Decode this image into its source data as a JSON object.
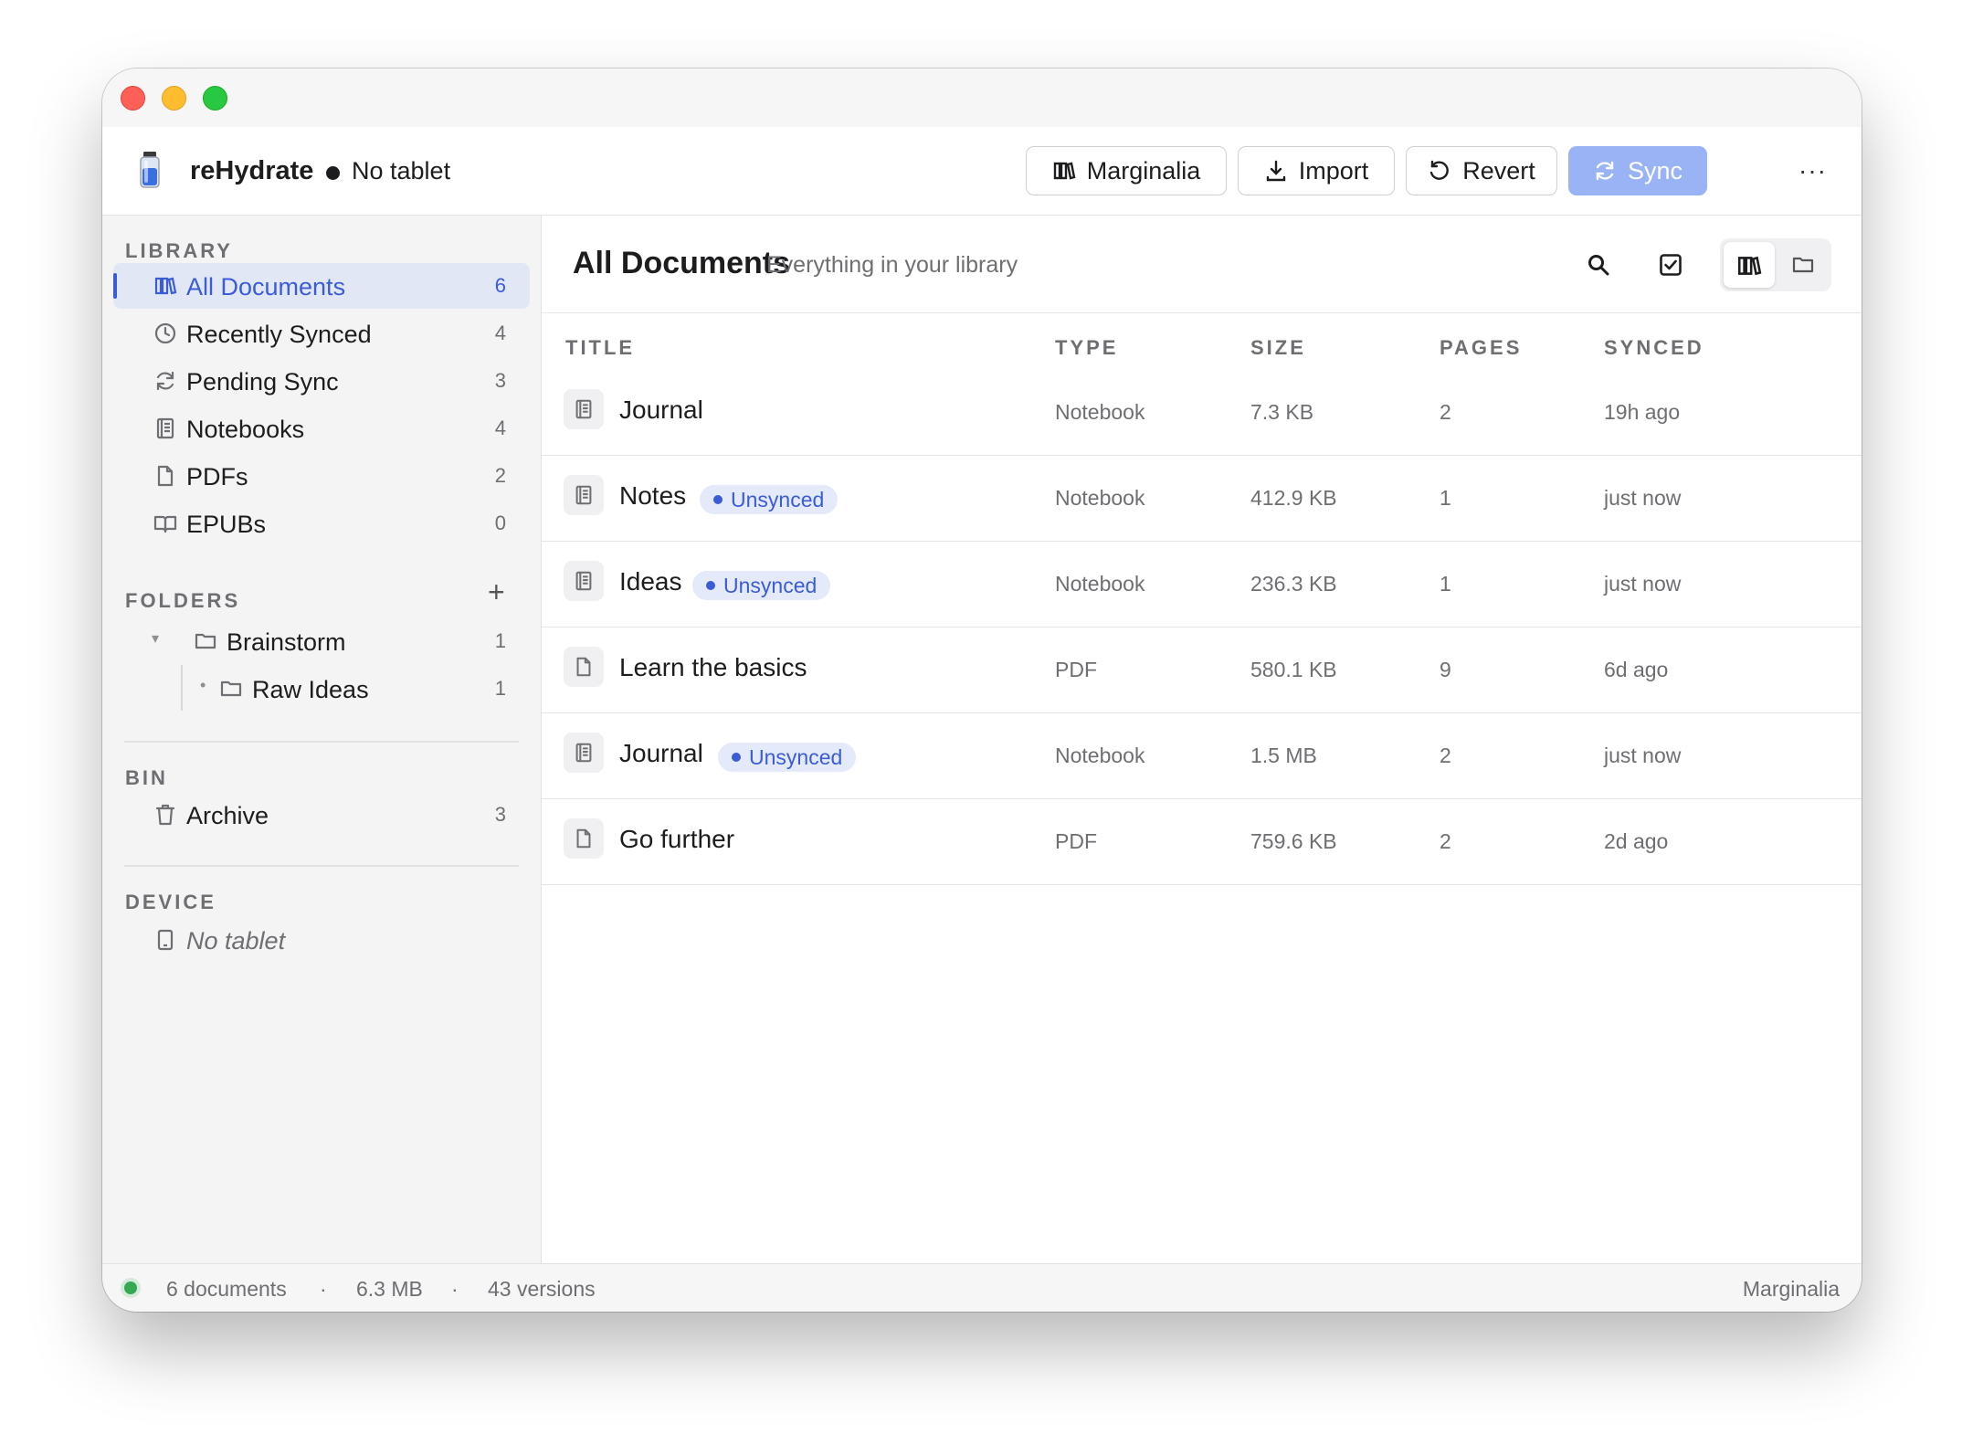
{
  "app": {
    "name": "reHydrate",
    "status": "No tablet"
  },
  "toolbar": {
    "buttons": [
      {
        "label": "Marginalia",
        "icon": "library-icon"
      },
      {
        "label": "Import",
        "icon": "download-icon"
      },
      {
        "label": "Revert",
        "icon": "revert-icon"
      },
      {
        "label": "Sync",
        "icon": "sync-icon"
      }
    ],
    "more": "···"
  },
  "sidebar": {
    "library": {
      "heading": "LIBRARY",
      "items": [
        {
          "label": "All Documents",
          "count": "6",
          "icon": "library-icon"
        },
        {
          "label": "Recently Synced",
          "count": "4",
          "icon": "clock-icon"
        },
        {
          "label": "Pending Sync",
          "count": "3",
          "icon": "sync-icon"
        },
        {
          "label": "Notebooks",
          "count": "4",
          "icon": "notebook-icon"
        },
        {
          "label": "PDFs",
          "count": "2",
          "icon": "file-icon"
        },
        {
          "label": "EPUBs",
          "count": "0",
          "icon": "book-icon"
        }
      ]
    },
    "folders": {
      "heading": "FOLDERS",
      "items": [
        {
          "label": "Brainstorm",
          "count": "1",
          "caret": "▾"
        },
        {
          "label": "Raw Ideas",
          "count": "1",
          "caret": "•"
        }
      ]
    },
    "bin": {
      "heading": "BIN",
      "items": [
        {
          "label": "Archive",
          "count": "3"
        }
      ]
    },
    "device": {
      "heading": "DEVICE",
      "items": [
        {
          "label": "No tablet"
        }
      ]
    }
  },
  "main": {
    "title": "All Documents",
    "subtitle": "Everything in your library",
    "columns": {
      "title": "TITLE",
      "type": "TYPE",
      "size": "SIZE",
      "pages": "PAGES",
      "synced": "SYNCED"
    },
    "rows": [
      {
        "title": "Journal",
        "badge": "",
        "type": "Notebook",
        "size": "7.3 KB",
        "pages": "2",
        "synced": "19h ago",
        "icon": "notebook-icon"
      },
      {
        "title": "Notes",
        "badge": "Unsynced",
        "type": "Notebook",
        "size": "412.9 KB",
        "pages": "1",
        "synced": "just now",
        "icon": "notebook-icon"
      },
      {
        "title": "Ideas",
        "badge": "Unsynced",
        "type": "Notebook",
        "size": "236.3 KB",
        "pages": "1",
        "synced": "just now",
        "icon": "notebook-icon"
      },
      {
        "title": "Learn the basics",
        "badge": "",
        "type": "PDF",
        "size": "580.1 KB",
        "pages": "9",
        "synced": "6d ago",
        "icon": "file-icon"
      },
      {
        "title": "Journal",
        "badge": "Unsynced",
        "type": "Notebook",
        "size": "1.5 MB",
        "pages": "2",
        "synced": "just now",
        "icon": "notebook-icon"
      },
      {
        "title": "Go further",
        "badge": "",
        "type": "PDF",
        "size": "759.6 KB",
        "pages": "2",
        "synced": "2d ago",
        "icon": "file-icon"
      }
    ]
  },
  "statusbar": {
    "documents": "6 documents",
    "size": "6.3 MB",
    "versions": "43 versions",
    "separator": "·",
    "right": "Marginalia"
  },
  "colors": {
    "accent": "#3a5cd6",
    "sync_button": "#9ab3f5",
    "badge_bg": "#e4eafa",
    "status_ok": "#34a853"
  }
}
